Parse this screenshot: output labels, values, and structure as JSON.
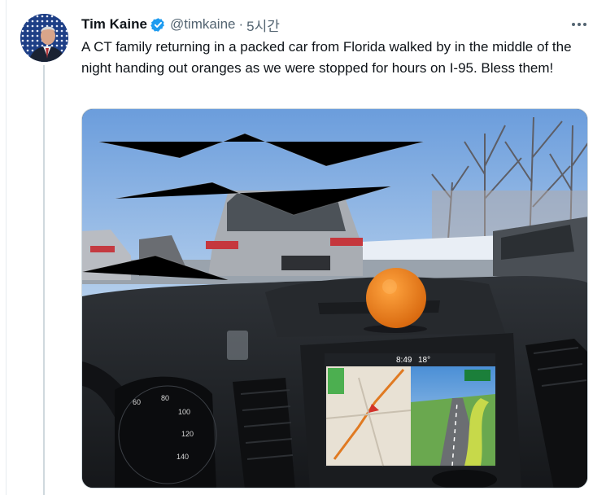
{
  "tweet": {
    "author_name": "Tim Kaine",
    "handle": "@timkaine",
    "separator": "·",
    "time": "5시간",
    "text": "A CT family returning in a packed car from Florida walked by in the middle of the night handing out oranges as we were stopped for hours on I-95. Bless them!",
    "verified": true,
    "verified_color": "#1d9bf0",
    "more_icon": "more-horizontal-icon"
  },
  "photo": {
    "nav_clock": "8:49",
    "nav_temp": "18°",
    "speedometer_ticks": [
      "60",
      "80",
      "100",
      "120",
      "140"
    ]
  },
  "colors": {
    "text_primary": "#0f1419",
    "text_secondary": "#536471",
    "sky": "#8fb8e6",
    "orange": "#f08a1e"
  }
}
